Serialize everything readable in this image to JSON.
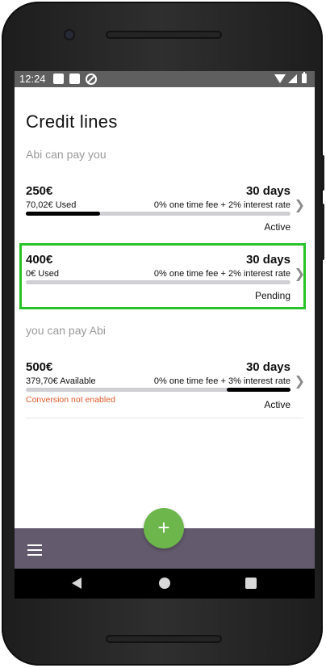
{
  "status_bar": {
    "time": "12:24"
  },
  "page": {
    "title": "Credit lines"
  },
  "sections": [
    {
      "label": "Abi can pay you"
    },
    {
      "label": "you can pay Abi"
    }
  ],
  "cards": [
    {
      "amount": "250€",
      "term": "30 days",
      "usage": "70,02€ Used",
      "rate": "0% one time fee + 2% interest rate",
      "status": "Active",
      "bar_fill_fraction": 0.28,
      "bar_fill_from": "left"
    },
    {
      "amount": "400€",
      "term": "30 days",
      "usage": "0€ Used",
      "rate": "0% one time fee + 2% interest rate",
      "status": "Pending",
      "bar_fill_fraction": 0.0,
      "bar_fill_from": "left"
    },
    {
      "amount": "500€",
      "term": "30 days",
      "usage": "379,70€ Available",
      "rate": "0% one time fee + 3% interest rate",
      "status": "Active",
      "note": "Conversion not enabled",
      "bar_fill_fraction": 0.24,
      "bar_fill_from": "right"
    }
  ],
  "fab": {
    "label": "+"
  },
  "colors": {
    "accent_green": "#6cb64b",
    "bottom_bar": "#635a6d",
    "highlight": "#28c328",
    "warning": "#e05a2a"
  },
  "icons": {
    "chevron": "chevron-right-icon",
    "menu": "menu-icon"
  }
}
